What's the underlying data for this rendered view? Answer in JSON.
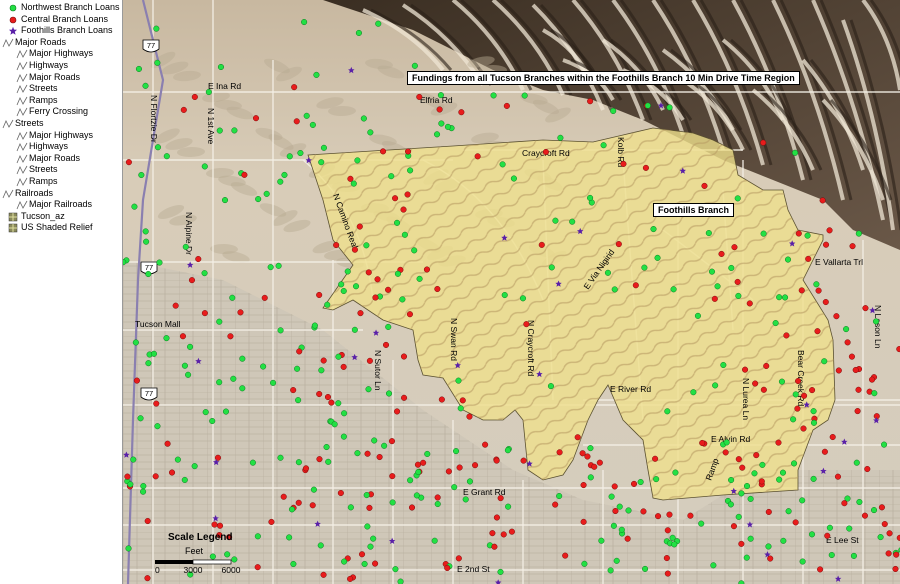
{
  "title": "Fundings from all Tucson Branches within the Foothills Branch 10 Min Drive Time Region",
  "branch_label": "Foothills Branch",
  "colors": {
    "northwest": "#22e044",
    "central": "#e81c1c",
    "foothills": "#5a20a8",
    "region_fill": "#efe08c",
    "mountains": "#5a4a3a",
    "desert": "#d6cbb8"
  },
  "legend": [
    {
      "label": "Northwest Branch Loans",
      "symbol": "dot-green",
      "indent": 1
    },
    {
      "label": "Central Branch Loans",
      "symbol": "dot-red",
      "indent": 1
    },
    {
      "label": "Foothills Branch Loans",
      "symbol": "star-purple",
      "indent": 1
    },
    {
      "label": "Major Roads",
      "symbol": "line-group",
      "indent": 0
    },
    {
      "label": "Major Highways",
      "symbol": "line",
      "indent": 2
    },
    {
      "label": "Highways",
      "symbol": "line",
      "indent": 2
    },
    {
      "label": "Major Roads",
      "symbol": "line",
      "indent": 2
    },
    {
      "label": "Streets",
      "symbol": "line",
      "indent": 2
    },
    {
      "label": "Ramps",
      "symbol": "line",
      "indent": 2
    },
    {
      "label": "Ferry Crossing",
      "symbol": "line",
      "indent": 2
    },
    {
      "label": "Streets",
      "symbol": "line-group",
      "indent": 0
    },
    {
      "label": "Major Highways",
      "symbol": "line",
      "indent": 2
    },
    {
      "label": "Highways",
      "symbol": "line",
      "indent": 2
    },
    {
      "label": "Major Roads",
      "symbol": "line",
      "indent": 2
    },
    {
      "label": "Streets",
      "symbol": "line",
      "indent": 2
    },
    {
      "label": "Ramps",
      "symbol": "line",
      "indent": 2
    },
    {
      "label": "Railroads",
      "symbol": "line-group",
      "indent": 0
    },
    {
      "label": "Major Railroads",
      "symbol": "line",
      "indent": 2
    },
    {
      "label": "Tucson_az",
      "symbol": "raster",
      "indent": 1
    },
    {
      "label": "US Shaded Relief",
      "symbol": "raster",
      "indent": 1
    }
  ],
  "road_labels": [
    "E Ina Rd",
    "Elfria Rd",
    "N Flortzie Dr",
    "N 1st Ave",
    "N Alpine Dr",
    "Craycroft Rd",
    "Kolb Rd",
    "N Camino Real",
    "N Swan Rd",
    "N Craycroft Rd",
    "E Via Nigirid",
    "E Vallarta Trl",
    "N Lason Ln",
    "Bear Creek Rd",
    "N Lurea Ln",
    "E River Rd",
    "E Alvin Rd",
    "Ramp",
    "E Grant Rd",
    "E 2nd St",
    "E Lee St",
    "N Sutor Ln",
    "Tucson Mall"
  ],
  "highway_shields": [
    "77",
    "77",
    "77"
  ],
  "scale_legend": {
    "title": "Scale Legend",
    "unit": "Feet",
    "ticks": [
      "0",
      "3000",
      "6000"
    ]
  }
}
